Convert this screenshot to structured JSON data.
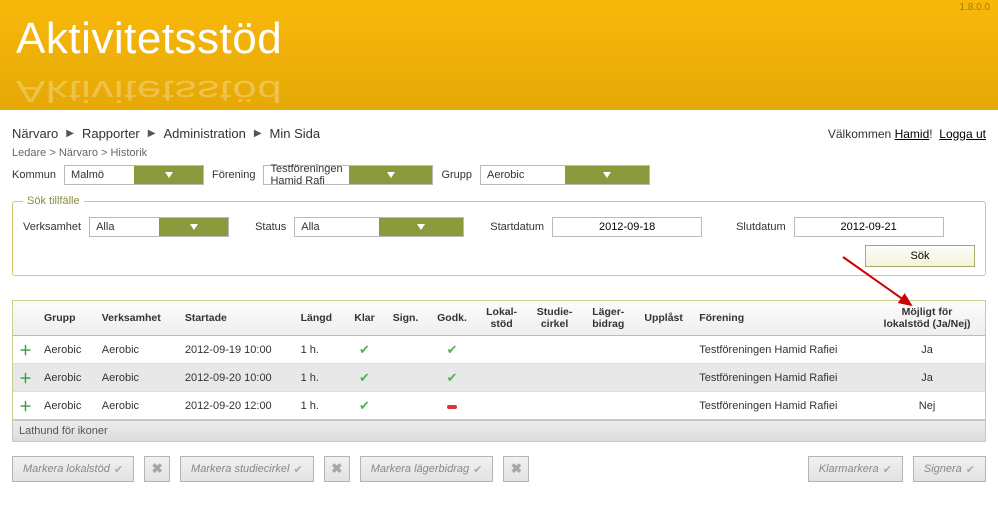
{
  "version": "1.8.0.0",
  "header": {
    "title": "Aktivitetsstöd"
  },
  "menu": {
    "narvaro": "Närvaro",
    "rapporter": "Rapporter",
    "administration": "Administration",
    "minsida": "Min Sida"
  },
  "welcome": {
    "prefix": "Välkommen ",
    "user": "Hamid",
    "suffix": "!",
    "logout": "Logga ut"
  },
  "breadcrumb": {
    "a": "Ledare",
    "b": "Närvaro",
    "c": "Historik"
  },
  "filters": {
    "kommun_label": "Kommun",
    "kommun_value": "Malmö",
    "forening_label": "Förening",
    "forening_value": "Testföreningen Hamid Rafi",
    "grupp_label": "Grupp",
    "grupp_value": "Aerobic"
  },
  "search": {
    "legend": "Sök tillfälle",
    "verksamhet_label": "Verksamhet",
    "verksamhet_value": "Alla",
    "status_label": "Status",
    "status_value": "Alla",
    "start_label": "Startdatum",
    "start_value": "2012-09-18",
    "slut_label": "Slutdatum",
    "slut_value": "2012-09-21",
    "btn": "Sök"
  },
  "table": {
    "headers": {
      "grupp": "Grupp",
      "verksamhet": "Verksamhet",
      "startade": "Startade",
      "langd": "Längd",
      "klar": "Klar",
      "sign": "Sign.",
      "godk": "Godk.",
      "lokal": "Lokal-\nstöd",
      "studie": "Studie-\ncirkel",
      "lager": "Läger-\nbidrag",
      "upplast": "Upplåst",
      "forening": "Förening",
      "mojligt": "Möjligt för\nlokalstöd (Ja/Nej)"
    },
    "rows": [
      {
        "grupp": "Aerobic",
        "verksamhet": "Aerobic",
        "startade": "2012-09-19 10:00",
        "langd": "1 h.",
        "klar": true,
        "godk": "ok",
        "forening": "Testföreningen Hamid Rafiei",
        "mojligt": "Ja"
      },
      {
        "grupp": "Aerobic",
        "verksamhet": "Aerobic",
        "startade": "2012-09-20 10:00",
        "langd": "1 h.",
        "klar": true,
        "godk": "ok",
        "forening": "Testföreningen Hamid Rafiei",
        "mojligt": "Ja"
      },
      {
        "grupp": "Aerobic",
        "verksamhet": "Aerobic",
        "startade": "2012-09-20 12:00",
        "langd": "1 h.",
        "klar": true,
        "godk": "no",
        "forening": "Testföreningen Hamid Rafiei",
        "mojligt": "Nej"
      }
    ]
  },
  "lathund": "Lathund för ikoner",
  "footer": {
    "markera_lokal": "Markera lokalstöd",
    "markera_studie": "Markera studiecirkel",
    "markera_lager": "Markera lägerbidrag",
    "klarmarkera": "Klarmarkera",
    "signera": "Signera"
  }
}
